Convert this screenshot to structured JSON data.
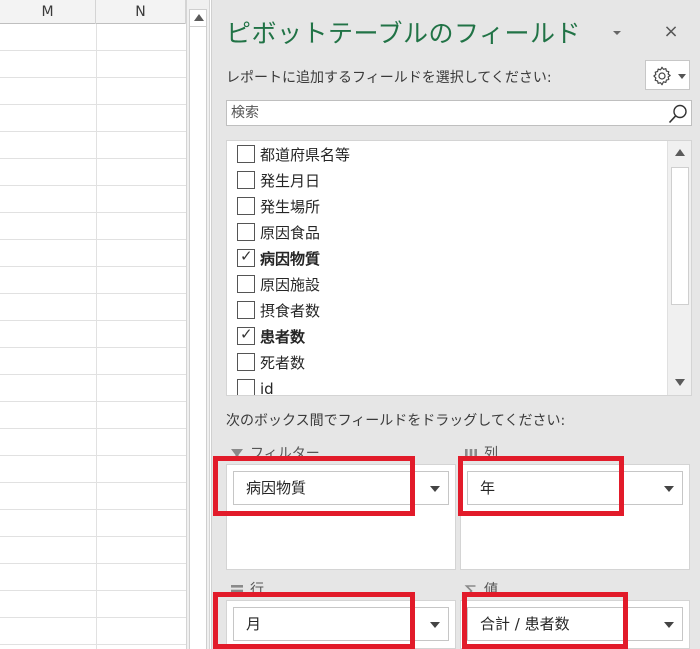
{
  "sheet": {
    "columns": [
      "M",
      "N"
    ]
  },
  "pane": {
    "title": "ピボットテーブルのフィールド",
    "close_glyph": "×",
    "subtitle": "レポートに追加するフィールドを選択してください:",
    "search_placeholder": "検索",
    "fields": [
      {
        "label": "都道府県名等",
        "checked": false
      },
      {
        "label": "発生月日",
        "checked": false
      },
      {
        "label": "発生場所",
        "checked": false
      },
      {
        "label": "原因食品",
        "checked": false
      },
      {
        "label": "病因物質",
        "checked": true
      },
      {
        "label": "原因施設",
        "checked": false
      },
      {
        "label": "摂食者数",
        "checked": false
      },
      {
        "label": "患者数",
        "checked": true
      },
      {
        "label": "死者数",
        "checked": false
      },
      {
        "label": "id",
        "checked": false
      }
    ],
    "drag_label": "次のボックス間でフィールドをドラッグしてください:",
    "areas": {
      "filter": {
        "header": "フィルター",
        "chip": "病因物質"
      },
      "columns": {
        "header": "列",
        "chip": "年"
      },
      "rows": {
        "header": "行",
        "chip": "月"
      },
      "values": {
        "header": "値",
        "chip": "合計 / 患者数"
      }
    },
    "colors": {
      "title": "#217346",
      "highlight": "#e21b2a"
    },
    "icons": [
      "gear-icon",
      "search-icon",
      "filter-icon",
      "columns-icon",
      "rows-icon",
      "sigma-icon"
    ]
  }
}
